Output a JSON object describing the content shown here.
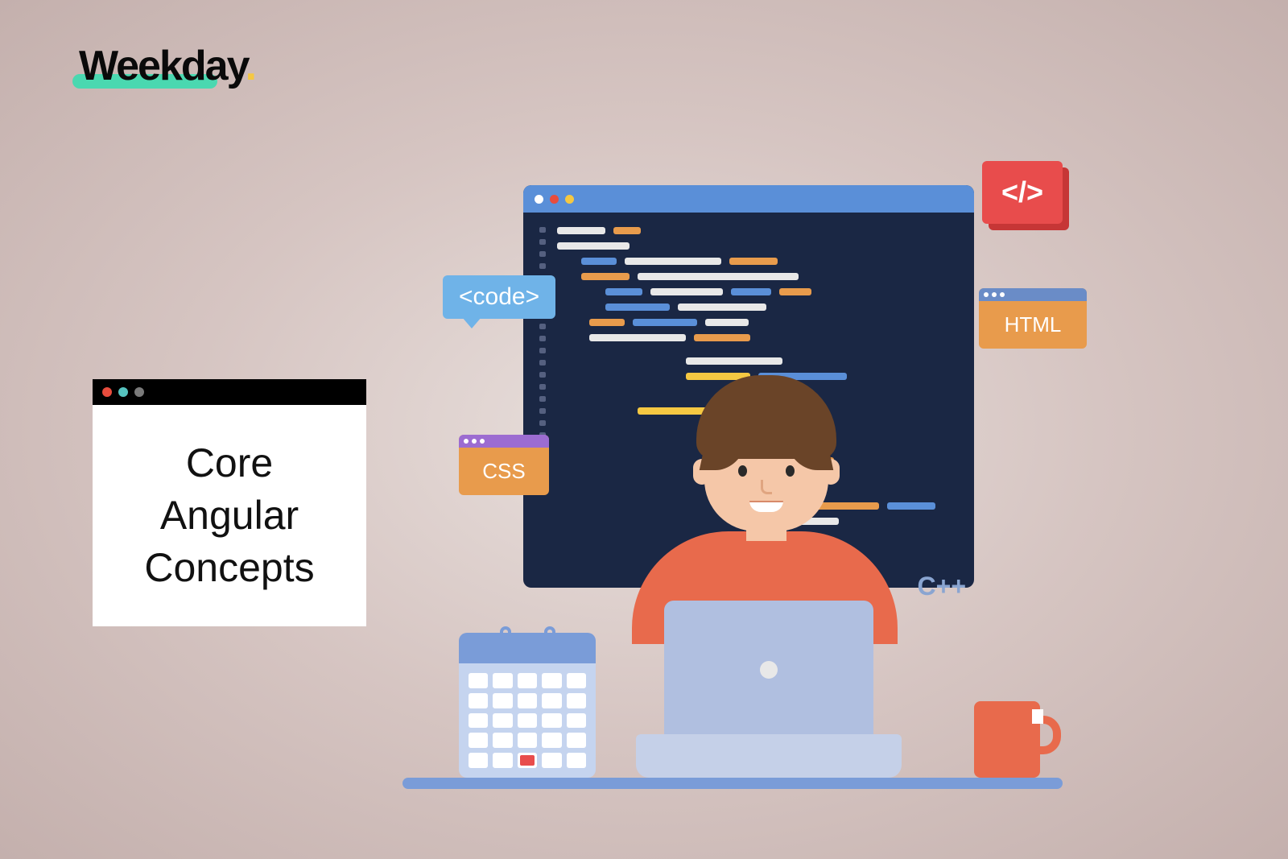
{
  "logo": {
    "text": "Weekday",
    "dot": "."
  },
  "title_card": {
    "line1": "Core",
    "line2": "Angular",
    "line3": "Concepts"
  },
  "badges": {
    "slash": "</>",
    "code_bubble": "<code>",
    "css": "CSS",
    "html": "HTML",
    "cpp": "C++"
  }
}
